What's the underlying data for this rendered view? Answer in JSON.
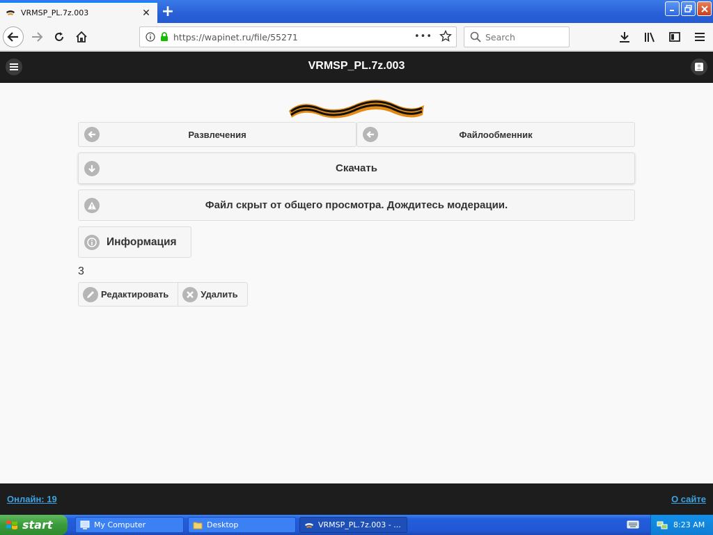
{
  "browser": {
    "tab_title": "VRMSP_PL.7z.003",
    "new_tab": "+",
    "url": "https://wapinet.ru/file/55271",
    "search_placeholder": "Search",
    "page_actions": "•••"
  },
  "site": {
    "title": "VRMSP_PL.7z.003",
    "nav": {
      "left_label": "Развлечения",
      "right_label": "Файлообменник"
    },
    "download_label": "Скачать",
    "notice": "Файл скрыт от общего просмотра. Дождитесь модерации.",
    "info_label": "Информация",
    "count": "3",
    "actions": {
      "edit_label": "Редактировать",
      "delete_label": "Удалить"
    },
    "footer": {
      "online": "Онлайн: 19",
      "about": "О сайте"
    }
  },
  "taskbar": {
    "start_label": "start",
    "tasks": [
      {
        "label": "My Computer"
      },
      {
        "label": "Desktop"
      },
      {
        "label": "VRMSP_PL.7z.003 - ..."
      }
    ],
    "clock": "8:23 AM"
  },
  "colors": {
    "header_bg": "#1d1d1d",
    "link": "#3ba3e4",
    "accent_tab": "#0a84ff"
  }
}
